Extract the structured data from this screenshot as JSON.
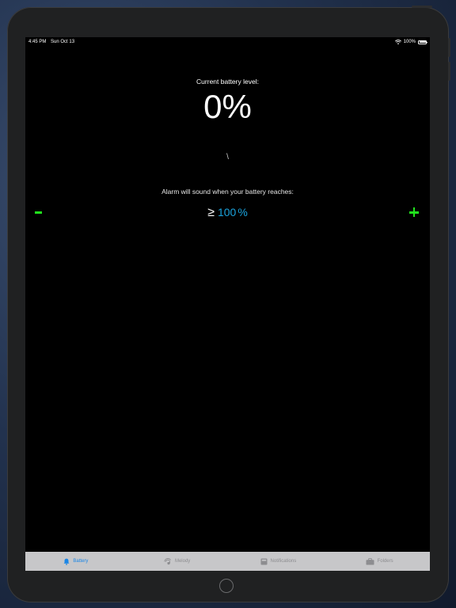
{
  "status_bar": {
    "time": "4:45 PM",
    "date": "Sun Oct 13",
    "battery_percent": "100%",
    "battery_level": 1.0
  },
  "main": {
    "title": "Current battery level:",
    "level": "0%",
    "spinner_glyph": "\\",
    "alarm_label": "Alarm will sound when your battery reaches:",
    "threshold_symbol": "≥",
    "threshold_value": "100",
    "threshold_unit": "%"
  },
  "tabs": [
    {
      "label": "Battery",
      "icon": "bell-icon",
      "active": true
    },
    {
      "label": "Melody",
      "icon": "melody-icon",
      "active": false
    },
    {
      "label": "Notifications",
      "icon": "notifications-icon",
      "active": false
    },
    {
      "label": "Folders",
      "icon": "briefcase-icon",
      "active": false
    }
  ],
  "colors": {
    "accent": "#1aa3dd",
    "stepper": "#21e31d",
    "tab_active": "#1a86e6",
    "tab_inactive": "#8d8d90",
    "tab_bar_bg": "#c7c7c9"
  }
}
